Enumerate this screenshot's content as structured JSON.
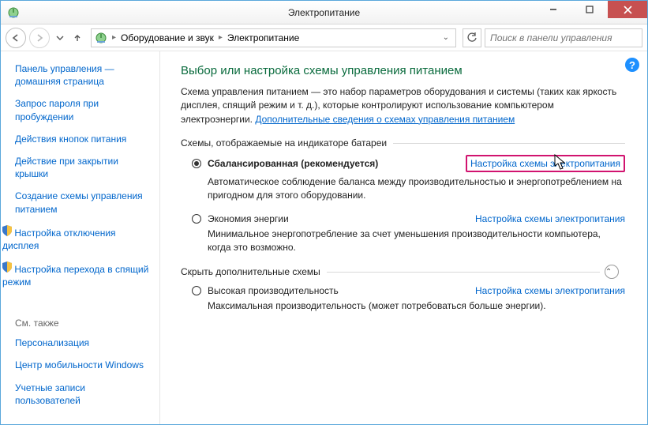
{
  "window": {
    "title": "Электропитание"
  },
  "toolbar": {
    "breadcrumb": [
      "Оборудование и звук",
      "Электропитание"
    ],
    "search_placeholder": "Поиск в панели управления"
  },
  "sidebar": {
    "links": [
      "Панель управления — домашняя страница",
      "Запрос пароля при пробуждении",
      "Действия кнопок питания",
      "Действие при закрытии крышки",
      "Создание схемы управления питанием",
      "Настройка отключения дисплея",
      "Настройка перехода в спящий режим"
    ],
    "see_also_label": "См. также",
    "see_also": [
      "Персонализация",
      "Центр мобильности Windows",
      "Учетные записи пользователей"
    ]
  },
  "main": {
    "heading": "Выбор или настройка схемы управления питанием",
    "description_prefix": "Схема управления питанием — это набор параметров оборудования и системы (таких как яркость дисплея, спящий режим и т. д.), которые контролируют использование компьютером электроэнергии. ",
    "description_link": "Дополнительные сведения о схемах управления питанием",
    "group1_label": "Схемы, отображаемые на индикаторе батареи",
    "group2_label": "Скрыть дополнительные схемы",
    "settings_link": "Настройка схемы электропитания",
    "plans": [
      {
        "name": "Сбалансированная (рекомендуется)",
        "desc": "Автоматическое соблюдение баланса между производительностью и энергопотреблением на пригодном для этого оборудовании.",
        "checked": true
      },
      {
        "name": "Экономия энергии",
        "desc": "Минимальное энергопотребление за счет уменьшения производительности компьютера, когда это возможно.",
        "checked": false
      },
      {
        "name": "Высокая производительность",
        "desc": "Максимальная производительность (может потребоваться больше энергии).",
        "checked": false
      }
    ]
  }
}
